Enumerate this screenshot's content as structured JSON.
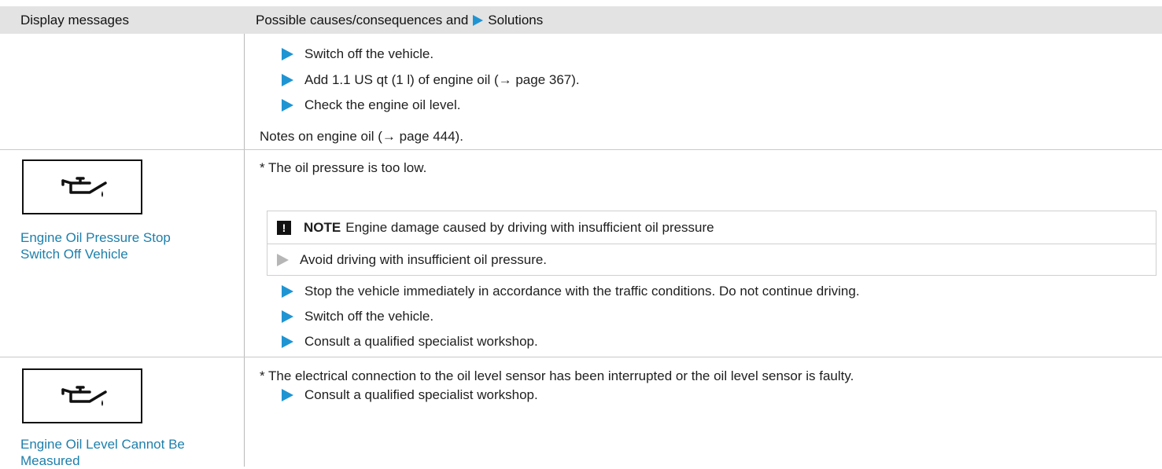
{
  "header": {
    "col1": "Display messages",
    "col2_pre": "Possible causes/consequences and",
    "col2_post": "Solutions"
  },
  "rows": [
    {
      "steps": [
        "Switch off the vehicle.",
        "Add 1.1 US qt (1 l) of engine oil (→ page 367).",
        "Check the engine oil level."
      ],
      "note": "Notes on engine oil (→ page 444)."
    },
    {
      "title_line1": "Engine Oil Pressure Stop",
      "title_line2": "Switch Off Vehicle",
      "cause": "* The oil pressure is too low.",
      "notice": {
        "label": "NOTE",
        "text": "Engine damage caused by driving with insufficient oil pressure",
        "step": "Avoid driving with insufficient oil pressure.",
        "icon": "!"
      },
      "steps": [
        "Stop the vehicle immediately in accordance with the traffic conditions. Do not continue driving.",
        "Switch off the vehicle.",
        "Consult a qualified specialist workshop."
      ]
    },
    {
      "title_line1": "Engine Oil Level Cannot Be",
      "title_line2": "Measured",
      "cause": "* The electrical connection to the oil level sensor has been interrupted or the oil level sensor is faulty.",
      "steps": [
        "Consult a qualified specialist workshop."
      ]
    }
  ],
  "colors": {
    "accent_arrow": "#1f94d3",
    "message_title": "#1d7fab",
    "header_bg": "#e3e3e3"
  },
  "icons": {
    "oil_can": "oil-can-icon",
    "step_arrow": "triangle-right-icon",
    "warning": "exclamation-icon"
  }
}
